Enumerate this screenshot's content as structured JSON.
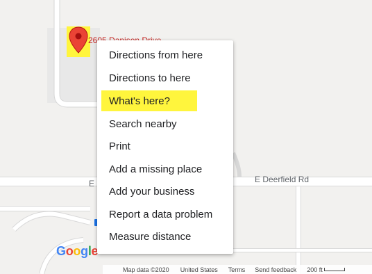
{
  "map": {
    "pin_label": "2605 Danison Drive",
    "road_labels": {
      "left": "E",
      "right": "E Deerfield Rd"
    },
    "google_logo": {
      "letters": [
        "G",
        "o",
        "o",
        "g",
        "l",
        "e"
      ]
    },
    "colors": {
      "background": "#f2f1ef",
      "road": "#ffffff",
      "road_outline": "#d8d8d8",
      "pin": "#ea4335",
      "pin_highlight": "#fff53d"
    }
  },
  "context_menu": {
    "items": [
      {
        "label": "Directions from here",
        "highlighted": false
      },
      {
        "label": "Directions to here",
        "highlighted": false
      },
      {
        "label": "What's here?",
        "highlighted": true
      },
      {
        "label": "Search nearby",
        "highlighted": false
      },
      {
        "label": "Print",
        "highlighted": false
      },
      {
        "label": "Add a missing place",
        "highlighted": false
      },
      {
        "label": "Add your business",
        "highlighted": false
      },
      {
        "label": "Report a data problem",
        "highlighted": false
      },
      {
        "label": "Measure distance",
        "highlighted": false
      }
    ],
    "highlight_color": "#fff53d"
  },
  "footer": {
    "map_data": "Map data ©2020",
    "country": "United States",
    "terms": "Terms",
    "send_feedback": "Send feedback",
    "scale": "200 ft"
  }
}
